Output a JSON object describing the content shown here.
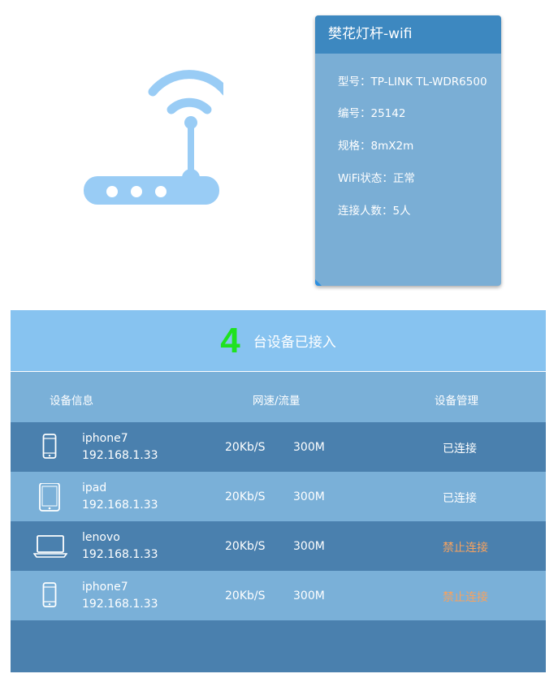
{
  "colors": {
    "card_header": "#3d88c0",
    "card_body": "#7aaed5",
    "banner": "#87c3f0",
    "row_dark": "#4a80ae",
    "row_light": "#7ab0d8",
    "count_accent": "#1fe21f",
    "blocked_status": "#f7a25f",
    "router_icon": "#99ccf5"
  },
  "illustration": {
    "icon": "wifi-router-icon"
  },
  "info_card": {
    "title": "樊花灯杆-wifi",
    "model": "型号：TP-LINK TL-WDR6500",
    "number": "编号：25142",
    "spec": "规格：8mX2m",
    "wifi_status": "WiFi状态：正常",
    "connections": "连接人数：5人"
  },
  "devices_panel": {
    "count": "4",
    "count_suffix": "台设备已接入",
    "headers": {
      "device_info": "设备信息",
      "speed_traffic": "网速/流量",
      "management": "设备管理"
    },
    "rows": [
      {
        "icon": "phone-icon",
        "name": "iphone7",
        "ip": "192.168.1.33",
        "speed": "20Kb/S",
        "traffic": "300M",
        "status": "已连接"
      },
      {
        "icon": "tablet-icon",
        "name": "ipad",
        "ip": "192.168.1.33",
        "speed": "20Kb/S",
        "traffic": "300M",
        "status": "已连接"
      },
      {
        "icon": "laptop-icon",
        "name": "lenovo",
        "ip": "192.168.1.33",
        "speed": "20Kb/S",
        "traffic": "300M",
        "status": "禁止连接"
      },
      {
        "icon": "phone-icon",
        "name": "iphone7",
        "ip": "192.168.1.33",
        "speed": "20Kb/S",
        "traffic": "300M",
        "status": "禁止连接"
      }
    ]
  }
}
